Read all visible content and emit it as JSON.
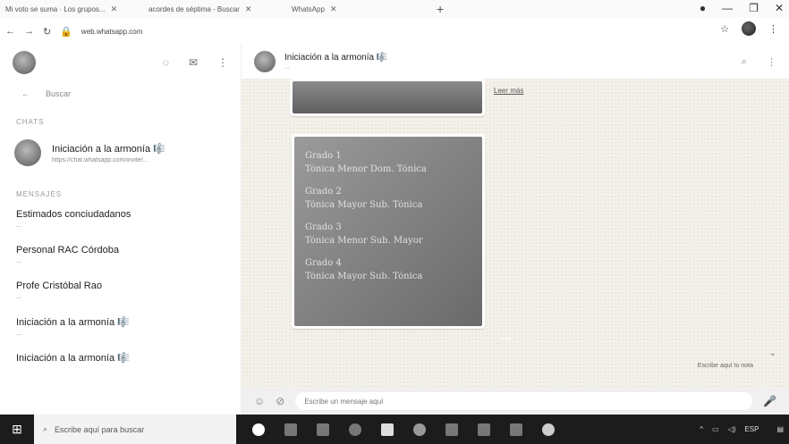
{
  "browser": {
    "tabs": [
      {
        "label": "Mi voto se suma · Los grupos..."
      },
      {
        "label": "acordes de séptima - Buscar"
      },
      {
        "label": "WhatsApp"
      }
    ],
    "new_tab": "+",
    "url": "web.whatsapp.com"
  },
  "left": {
    "search_placeholder": "Buscar",
    "chats_label": "CHATS",
    "featured": {
      "title": "Iniciación a la armonía 🎼",
      "subtitle": "https://chat.whatsapp.com/invite/...",
      "time": ""
    },
    "messages_label": "MENSAJES",
    "items": [
      {
        "title": "Estimados conciudadanos",
        "subtitle": "...",
        "time": ""
      },
      {
        "title": "Personal RAC Córdoba",
        "subtitle": "...",
        "time": ""
      },
      {
        "title": "Profe Cristóbal Rao",
        "subtitle": "...",
        "time": ""
      },
      {
        "title": "Iniciación a la armonía 🎼",
        "subtitle": "...",
        "time": ""
      },
      {
        "title": "Iniciación a la armonía 🎼",
        "subtitle": "",
        "time": ""
      }
    ]
  },
  "conversation": {
    "title": "Iniciación a la armonía 🎼",
    "subtitle": "...",
    "side_link": "Leer más",
    "top_photo_time": "",
    "msg_info": "",
    "main_photo_time": "",
    "handwritten_lines": [
      "Grado 1",
      "Tónica Menor Dom. Tónica",
      "Grado 2",
      "Tónica Mayor Sub. Tónica",
      "Grado 3",
      "Tónica Menor Sub. Mayor",
      "Grado 4",
      "Tónica Mayor Sub. Tónica"
    ],
    "date_pill": "",
    "notice": "Escribe aquí tu nota",
    "input_placeholder": "Escribe un mensaje aquí"
  },
  "taskbar": {
    "search_placeholder": "Escribe aquí para buscar",
    "lang": "ESP",
    "time": "",
    "date": ""
  }
}
